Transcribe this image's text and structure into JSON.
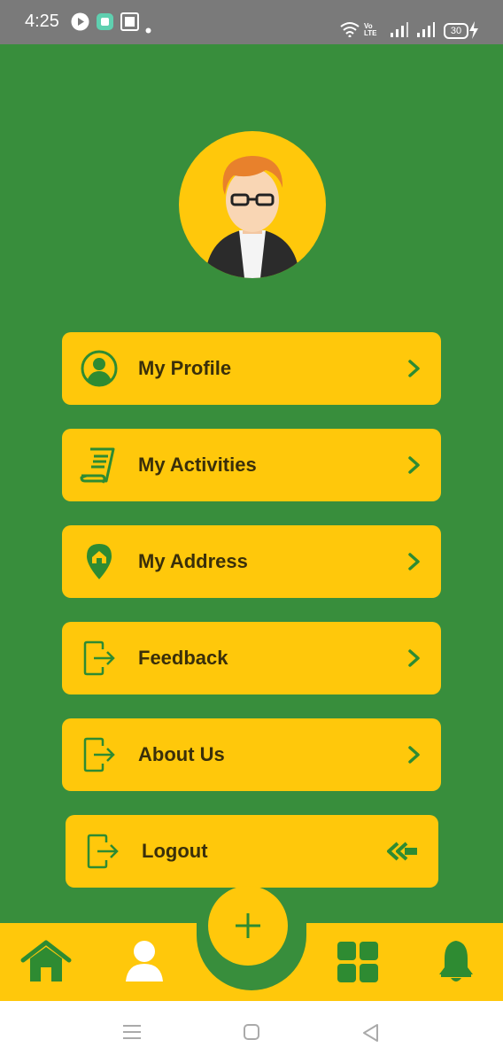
{
  "status_bar": {
    "time": "4:25",
    "battery": "30",
    "network_label": "Vo LTE"
  },
  "profile": {
    "avatar_icon": "user-avatar-icon"
  },
  "menu": {
    "items": [
      {
        "label": "My Profile",
        "icon": "person-circle-icon"
      },
      {
        "label": "My Activities",
        "icon": "scroll-document-icon"
      },
      {
        "label": "My Address",
        "icon": "home-location-pin-icon"
      },
      {
        "label": "Feedback",
        "icon": "exit-door-icon"
      },
      {
        "label": "About Us",
        "icon": "exit-door-icon"
      },
      {
        "label": "Logout",
        "icon": "exit-door-icon"
      }
    ]
  },
  "bottom_nav": {
    "items": [
      "home-icon",
      "profile-icon",
      "add-icon",
      "grid-icon",
      "bell-icon"
    ],
    "active": "profile-icon"
  },
  "colors": {
    "background": "#388E3C",
    "accent": "#FFC80B",
    "icon": "#2E8B32",
    "text": "#3a2f0a"
  }
}
